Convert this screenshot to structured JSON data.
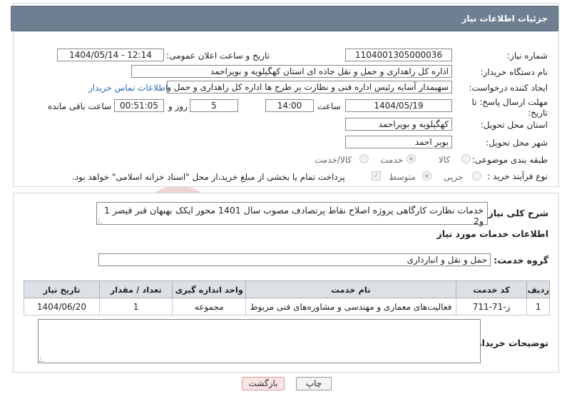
{
  "header": {
    "title": "جزئیات اطلاعات نیاز"
  },
  "form": {
    "need_number_label": "شماره نیاز:",
    "need_number": "1104001305000036",
    "announce_label": "تاریخ و ساعت اعلان عمومی:",
    "announce_value": "1404/05/14 - 12:14",
    "buyer_org_label": "نام دستگاه خریدار:",
    "buyer_org": "اداره کل راهداری و حمل و نقل جاده ای استان کهگیلویه و بویراحمد",
    "creator_label": "ایجاد کننده درخواست:",
    "creator": "سهیمدار آسایه رئیس اداره فنی و نظارت بر طرح ها اداره کل راهداری و حمل و نقل",
    "contact_link": "اطلاعات تماس خریدار",
    "deadline_label": "مهلت ارسال پاسخ: تا تاریخ:",
    "deadline_date": "1404/05/19",
    "time_label": "ساعت",
    "deadline_time": "14:00",
    "days_value": "5",
    "days_label": "روز و",
    "remaining_time": "00:51:05",
    "remaining_label": "ساعت باقی مانده",
    "province_label": "استان محل تحویل:",
    "province": "کهگیلویه و بویراحمد",
    "city_label": "شهر محل تحویل:",
    "city": "بویر احمد",
    "category_label": "طبقه بندی موضوعی:",
    "category_options": [
      "کالا",
      "خدمت",
      "کالا/خدمت"
    ],
    "category_selected": "خدمت",
    "purchase_type_label": "نوع فرآیند خرید :",
    "purchase_options": [
      "جزیی",
      "متوسط"
    ],
    "purchase_selected": "متوسط",
    "payment_note": "پرداخت تمام یا بخشی از مبلغ خرید،از محل \"اسناد خزانه اسلامی\" خواهد بود."
  },
  "details": {
    "summary_label": "شرح کلی نیاز:",
    "summary": "خدمات نظارت کارگاهی پروژه اصلاح نقاط پرتصادف مصوب سال 1401 محور ایکک بهبهان قبر قیصر 1 و2",
    "services_heading": "اطلاعات خدمات مورد نیاز",
    "service_group_label": "گروه خدمت:",
    "service_group": "حمل و نقل و انبارداری",
    "table": {
      "headers": [
        "ردیف",
        "کد خدمت",
        "نام خدمت",
        "واحد اندازه گیری",
        "تعداد / مقدار",
        "تاریخ نیاز"
      ],
      "rows": [
        [
          "1",
          "ز-71-711",
          "فعالیت‌های معماری و مهندسی و مشاوره‌های فنی مربوط",
          "مجموعه",
          "1",
          "1404/06/20"
        ]
      ]
    },
    "buyer_notes_label": "توضیحات خریدار:",
    "buyer_notes": ""
  },
  "buttons": {
    "print": "چاپ",
    "back": "بازگشت"
  },
  "watermark": {
    "text": "AriaTender.neT"
  }
}
